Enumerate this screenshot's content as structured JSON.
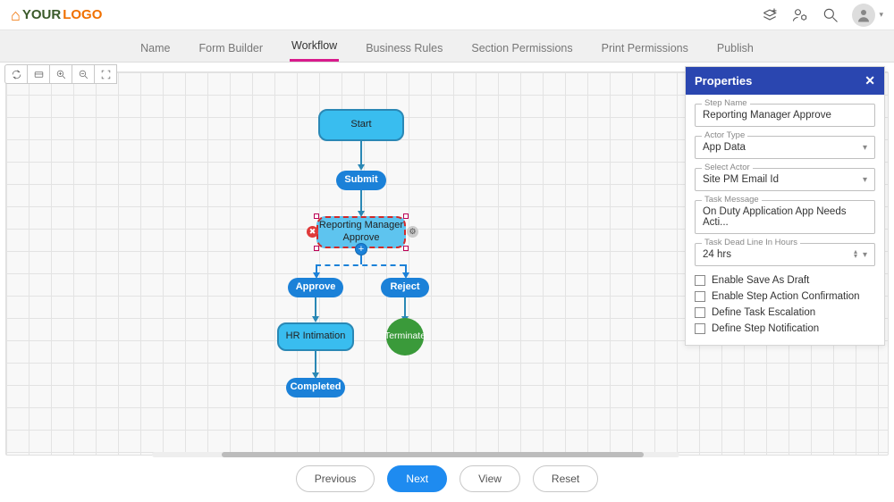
{
  "logo": {
    "part1": "YOUR",
    "part2": "LOGO"
  },
  "tabs": [
    "Name",
    "Form Builder",
    "Workflow",
    "Business Rules",
    "Section Permissions",
    "Print Permissions",
    "Publish"
  ],
  "active_tab": 2,
  "toolbar": {
    "refresh": "refresh",
    "pan": "pan",
    "zoom_in": "zoom-in",
    "zoom_out": "zoom-out",
    "fit": "fit"
  },
  "nodes": {
    "start": "Start",
    "submit": "Submit",
    "rma": "Reporting Manager Approve",
    "approve": "Approve",
    "reject": "Reject",
    "hr": "HR Intimation",
    "terminate": "Terminate",
    "completed": "Completed"
  },
  "properties": {
    "title": "Properties",
    "step_name": {
      "label": "Step Name",
      "value": "Reporting Manager Approve"
    },
    "actor_type": {
      "label": "Actor Type",
      "value": "App Data"
    },
    "select_actor": {
      "label": "Select Actor",
      "value": "Site PM Email Id"
    },
    "task_message": {
      "label": "Task Message",
      "value": "On Duty Application App Needs Acti..."
    },
    "deadline": {
      "label": "Task Dead Line In Hours",
      "value": "24 hrs"
    },
    "checks": [
      "Enable Save As Draft",
      "Enable Step Action Confirmation",
      "Define Task Escalation",
      "Define Step Notification"
    ]
  },
  "footer": {
    "previous": "Previous",
    "next": "Next",
    "view": "View",
    "reset": "Reset"
  }
}
